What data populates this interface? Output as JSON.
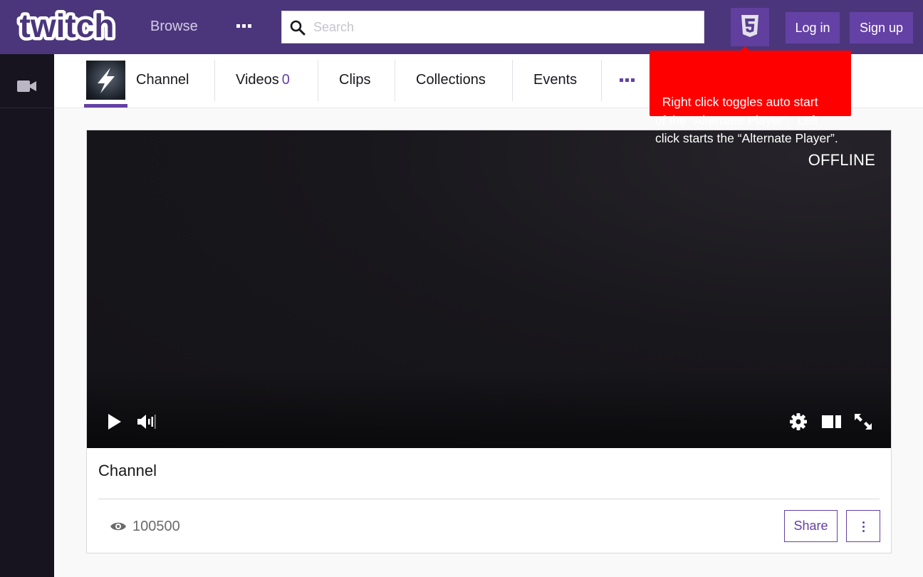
{
  "header": {
    "logo_text": "twitch",
    "browse_label": "Browse",
    "more_icon": "ellipsis-icon",
    "search": {
      "placeholder": "Search",
      "value": "",
      "icon": "search-icon"
    },
    "html5_icon": "html5-icon",
    "login_label": "Log in",
    "signup_label": "Sign up"
  },
  "tooltip": {
    "text": "Right click toggles auto start\nof the “Alternate Player”.  Left\nclick starts the “Alternate Player”.",
    "color": "#ff0000"
  },
  "sidebar": {
    "icon": "video-camera-icon"
  },
  "channel_nav": {
    "tabs": [
      {
        "label": "Channel",
        "count": ""
      },
      {
        "label": "Videos",
        "count": "0"
      },
      {
        "label": "Clips",
        "count": ""
      },
      {
        "label": "Collections",
        "count": ""
      },
      {
        "label": "Events",
        "count": ""
      }
    ],
    "active_tab": "Channel",
    "more_icon": "ellipsis-icon"
  },
  "player": {
    "status": "OFFLINE",
    "controls": [
      "play-icon",
      "volume-icon",
      "settings-icon",
      "theatre-mode-icon",
      "fullscreen-icon"
    ]
  },
  "stream": {
    "title": "Channel",
    "view_count": "100500",
    "share_label": "Share"
  },
  "colors": {
    "brand": "#6441a4",
    "topbar": "#4b367c",
    "sidebar": "#17141f"
  }
}
